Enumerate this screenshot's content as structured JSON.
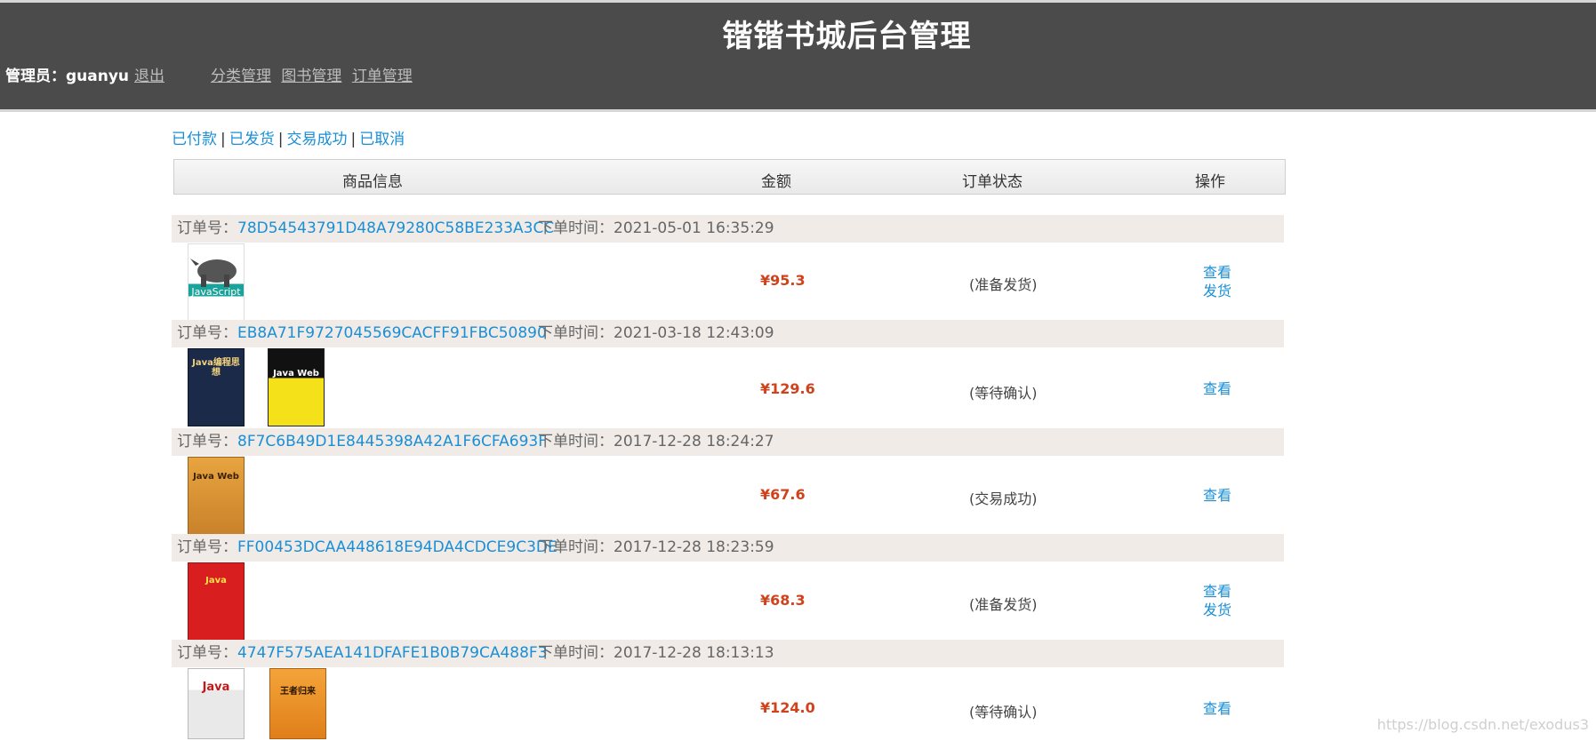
{
  "header": {
    "title": "锴锴书城后台管理",
    "admin_label": "管理员：guanyu",
    "logout": "退出",
    "nav": [
      "分类管理",
      "图书管理",
      "订单管理"
    ]
  },
  "filters": [
    "已付款",
    "已发货",
    "交易成功",
    "已取消"
  ],
  "table": {
    "columns": [
      "商品信息",
      "金额",
      "订单状态",
      "操作"
    ]
  },
  "order_labels": {
    "order_no": "订单号：",
    "order_time": "下单时间："
  },
  "orders": [
    {
      "id": "78D54543791D48A79280C58BE233A3CC",
      "time": "2021-05-01 16:35:29",
      "amount": "¥95.3",
      "status": "(准备发货)",
      "actions": [
        "查看",
        "发货"
      ],
      "books": [
        {
          "cover_text": "JavaScript"
        }
      ]
    },
    {
      "id": "EB8A71F9727045569CACFF91FBC50890",
      "time": "2021-03-18 12:43:09",
      "amount": "¥129.6",
      "status": "(等待确认)",
      "actions": [
        "查看"
      ],
      "books": [
        {
          "cover_text": "Java编程思想"
        },
        {
          "cover_text": "Java Web"
        }
      ]
    },
    {
      "id": "8F7C6B49D1E8445398A42A1F6CFA693F",
      "time": "2017-12-28 18:24:27",
      "amount": "¥67.6",
      "status": "(交易成功)",
      "actions": [
        "查看"
      ],
      "books": [
        {
          "cover_text": "Java Web"
        }
      ]
    },
    {
      "id": "FF00453DCAA448618E94DA4CDCE9C3DE",
      "time": "2017-12-28 18:23:59",
      "amount": "¥68.3",
      "status": "(准备发货)",
      "actions": [
        "查看",
        "发货"
      ],
      "books": [
        {
          "cover_text": "Java"
        }
      ]
    },
    {
      "id": "4747F575AEA141DFAFE1B0B79CA488F3",
      "time": "2017-12-28 18:13:13",
      "amount": "¥124.0",
      "status": "(等待确认)",
      "actions": [
        "查看"
      ],
      "books": [
        {
          "cover_text": "Java"
        },
        {
          "cover_text": "王者归来"
        }
      ]
    }
  ],
  "watermark": "https://blog.csdn.net/exodus3",
  "colors": {
    "header_bg": "#4b4b4b",
    "link": "#1a8fd6",
    "amount": "#d0421b",
    "order_head_bg": "#f0ebe7"
  }
}
